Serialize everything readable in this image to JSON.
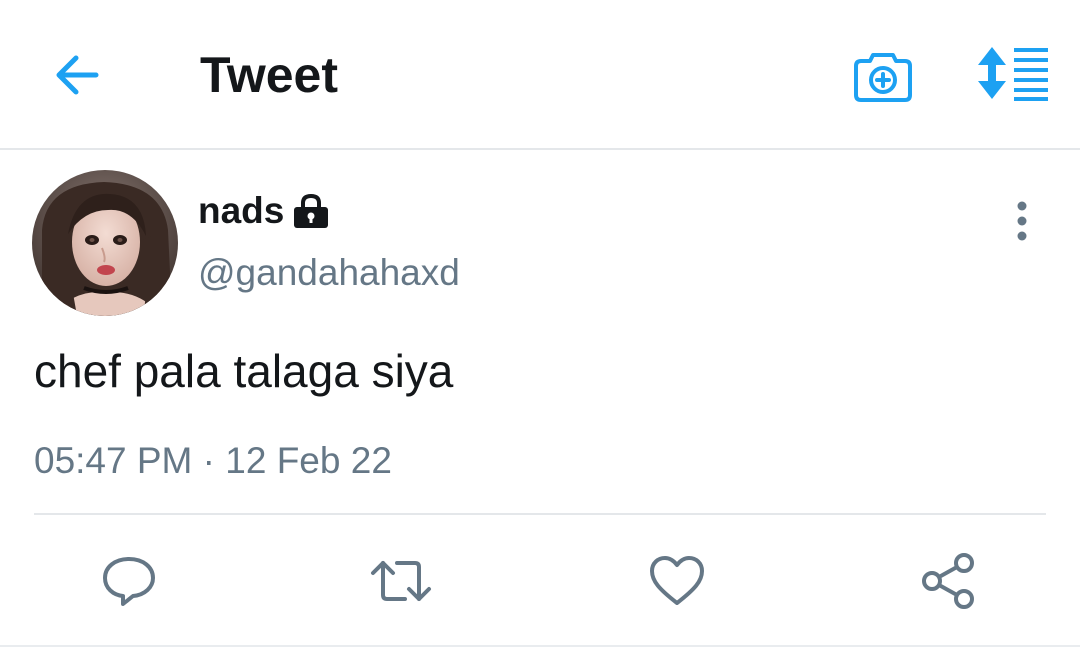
{
  "header": {
    "title": "Tweet",
    "back_icon": "arrow-left-icon",
    "camera_icon": "camera-plus-icon",
    "sort_icon": "sort-list-icon",
    "accent": "#1da1f2"
  },
  "tweet": {
    "author": {
      "display_name": "nads",
      "handle": "@gandahahaxd",
      "protected": true,
      "lock_icon": "lock-icon"
    },
    "text": "chef pala talaga siya",
    "time": "05:47 PM",
    "separator": "·",
    "date": "12 Feb 22"
  },
  "actions": {
    "reply_icon": "reply-icon",
    "retweet_icon": "retweet-icon",
    "like_icon": "heart-icon",
    "share_icon": "share-icon",
    "icon_color": "#657786"
  },
  "colors": {
    "primary_text": "#14171a",
    "secondary_text": "#657786",
    "divider": "#e4e7ea"
  }
}
